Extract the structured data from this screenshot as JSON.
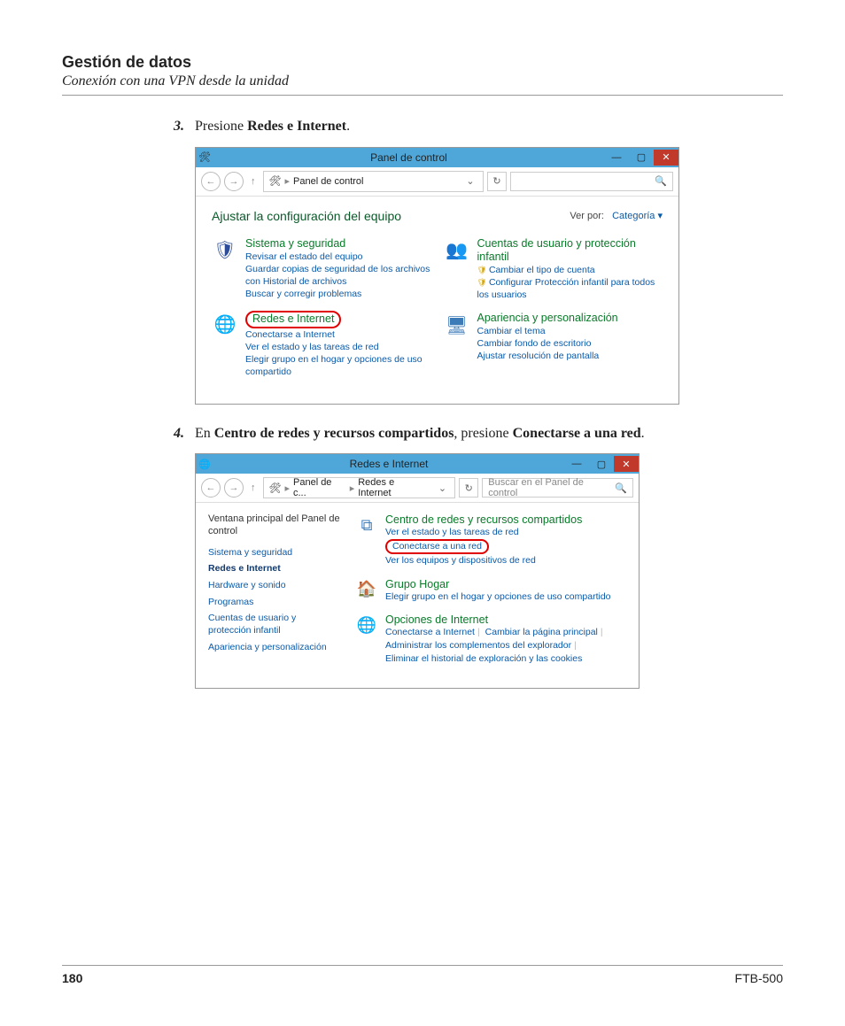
{
  "header": {
    "title": "Gestión de datos",
    "subtitle": "Conexión con una VPN desde la unidad"
  },
  "steps": {
    "s3": {
      "num": "3.",
      "pre": "Presione ",
      "bold": "Redes e Internet",
      "post": "."
    },
    "s4": {
      "num": "4.",
      "pre": "En ",
      "bold1": "Centro de redes y recursos compartidos",
      "mid": ", presione ",
      "bold2": "Conectarse a una red",
      "post": "."
    }
  },
  "shot1": {
    "title": "Panel de control",
    "crumb": "Panel de control",
    "heading": "Ajustar la configuración del equipo",
    "viewby_label": "Ver por:",
    "viewby_value": "Categoría",
    "cats": {
      "sys": {
        "title": "Sistema y seguridad",
        "links": [
          "Revisar el estado del equipo",
          "Guardar copias de seguridad de los archivos con Historial de archivos",
          "Buscar y corregir problemas"
        ]
      },
      "net": {
        "title": "Redes e Internet",
        "links": [
          "Conectarse a Internet",
          "Ver el estado y las tareas de red",
          "Elegir grupo en el hogar y opciones de uso compartido"
        ]
      },
      "users": {
        "title": "Cuentas de usuario y protección infantil",
        "links": [
          "Cambiar el tipo de cuenta",
          "Configurar Protección infantil para todos los usuarios"
        ]
      },
      "appearance": {
        "title": "Apariencia y personalización",
        "links": [
          "Cambiar el tema",
          "Cambiar fondo de escritorio",
          "Ajustar resolución de pantalla"
        ]
      }
    }
  },
  "shot2": {
    "title": "Redes e Internet",
    "crumb1": "Panel de c...",
    "crumb2": "Redes e Internet",
    "search_placeholder": "Buscar en el Panel de control",
    "side_title": "Ventana principal del Panel de control",
    "side_links": {
      "l1": "Sistema y seguridad",
      "l2": "Redes e Internet",
      "l3": "Hardware y sonido",
      "l4": "Programas",
      "l5": "Cuentas de usuario y protección infantil",
      "l6": "Apariencia y personalización"
    },
    "items": {
      "net": {
        "title": "Centro de redes y recursos compartidos",
        "l1": "Ver el estado y las tareas de red",
        "l2": "Conectarse a una red",
        "l3": "Ver los equipos y dispositivos de red"
      },
      "home": {
        "title": "Grupo Hogar",
        "l1": "Elegir grupo en el hogar y opciones de uso compartido"
      },
      "inet": {
        "title": "Opciones de Internet",
        "l1": "Conectarse a Internet",
        "l2": "Cambiar la página principal",
        "l3": "Administrar los complementos del explorador",
        "l4": "Eliminar el historial de exploración y las cookies"
      }
    }
  },
  "footer": {
    "page": "180",
    "model": "FTB-500"
  }
}
